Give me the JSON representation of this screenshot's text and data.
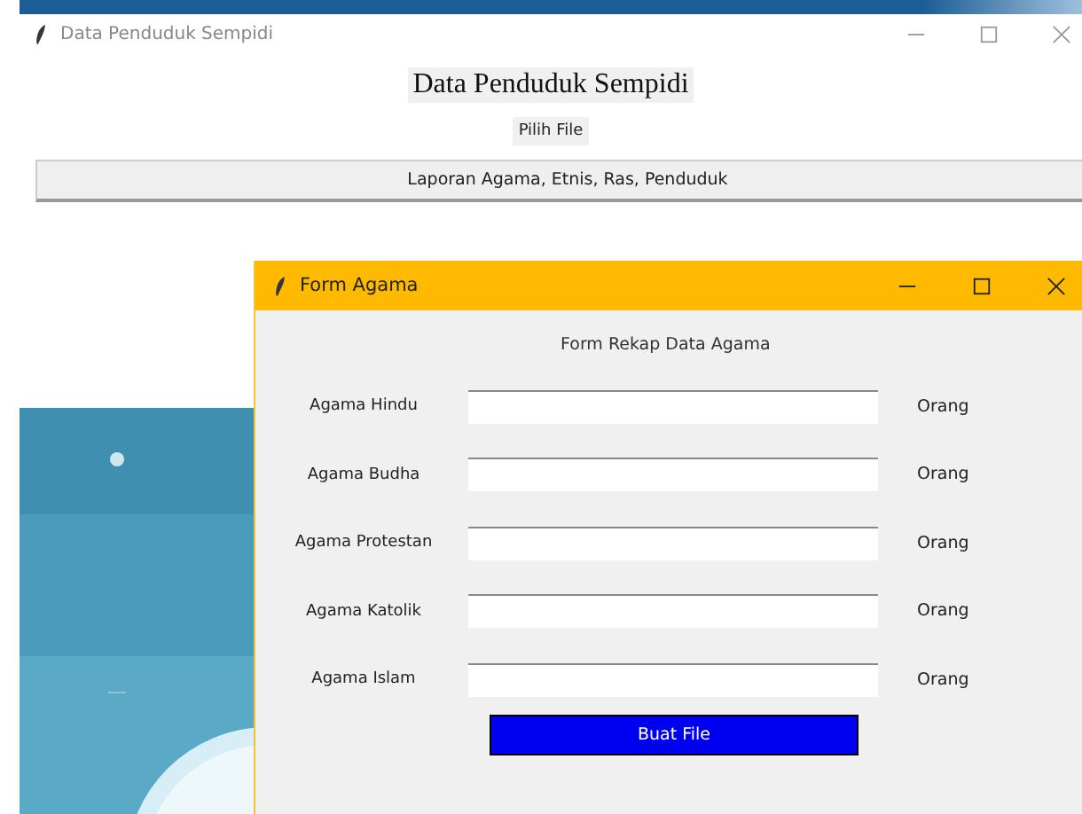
{
  "main_window": {
    "title": "Data Penduduk Sempidi",
    "heading": "Data Penduduk Sempidi",
    "choose_button": "Pilih File",
    "report_button": "Laporan Agama, Etnis, Ras, Penduduk"
  },
  "dialog": {
    "title": "Form Agama",
    "heading": "Form Rekap Data Agama",
    "fields": [
      {
        "label": "Agama Hindu",
        "unit": "Orang"
      },
      {
        "label": "Agama Budha",
        "unit": "Orang"
      },
      {
        "label": "Agama Protestan",
        "unit": "Orang"
      },
      {
        "label": "Agama Katolik",
        "unit": "Orang"
      },
      {
        "label": "Agama Islam",
        "unit": "Orang"
      }
    ],
    "submit_button": "Buat File"
  }
}
